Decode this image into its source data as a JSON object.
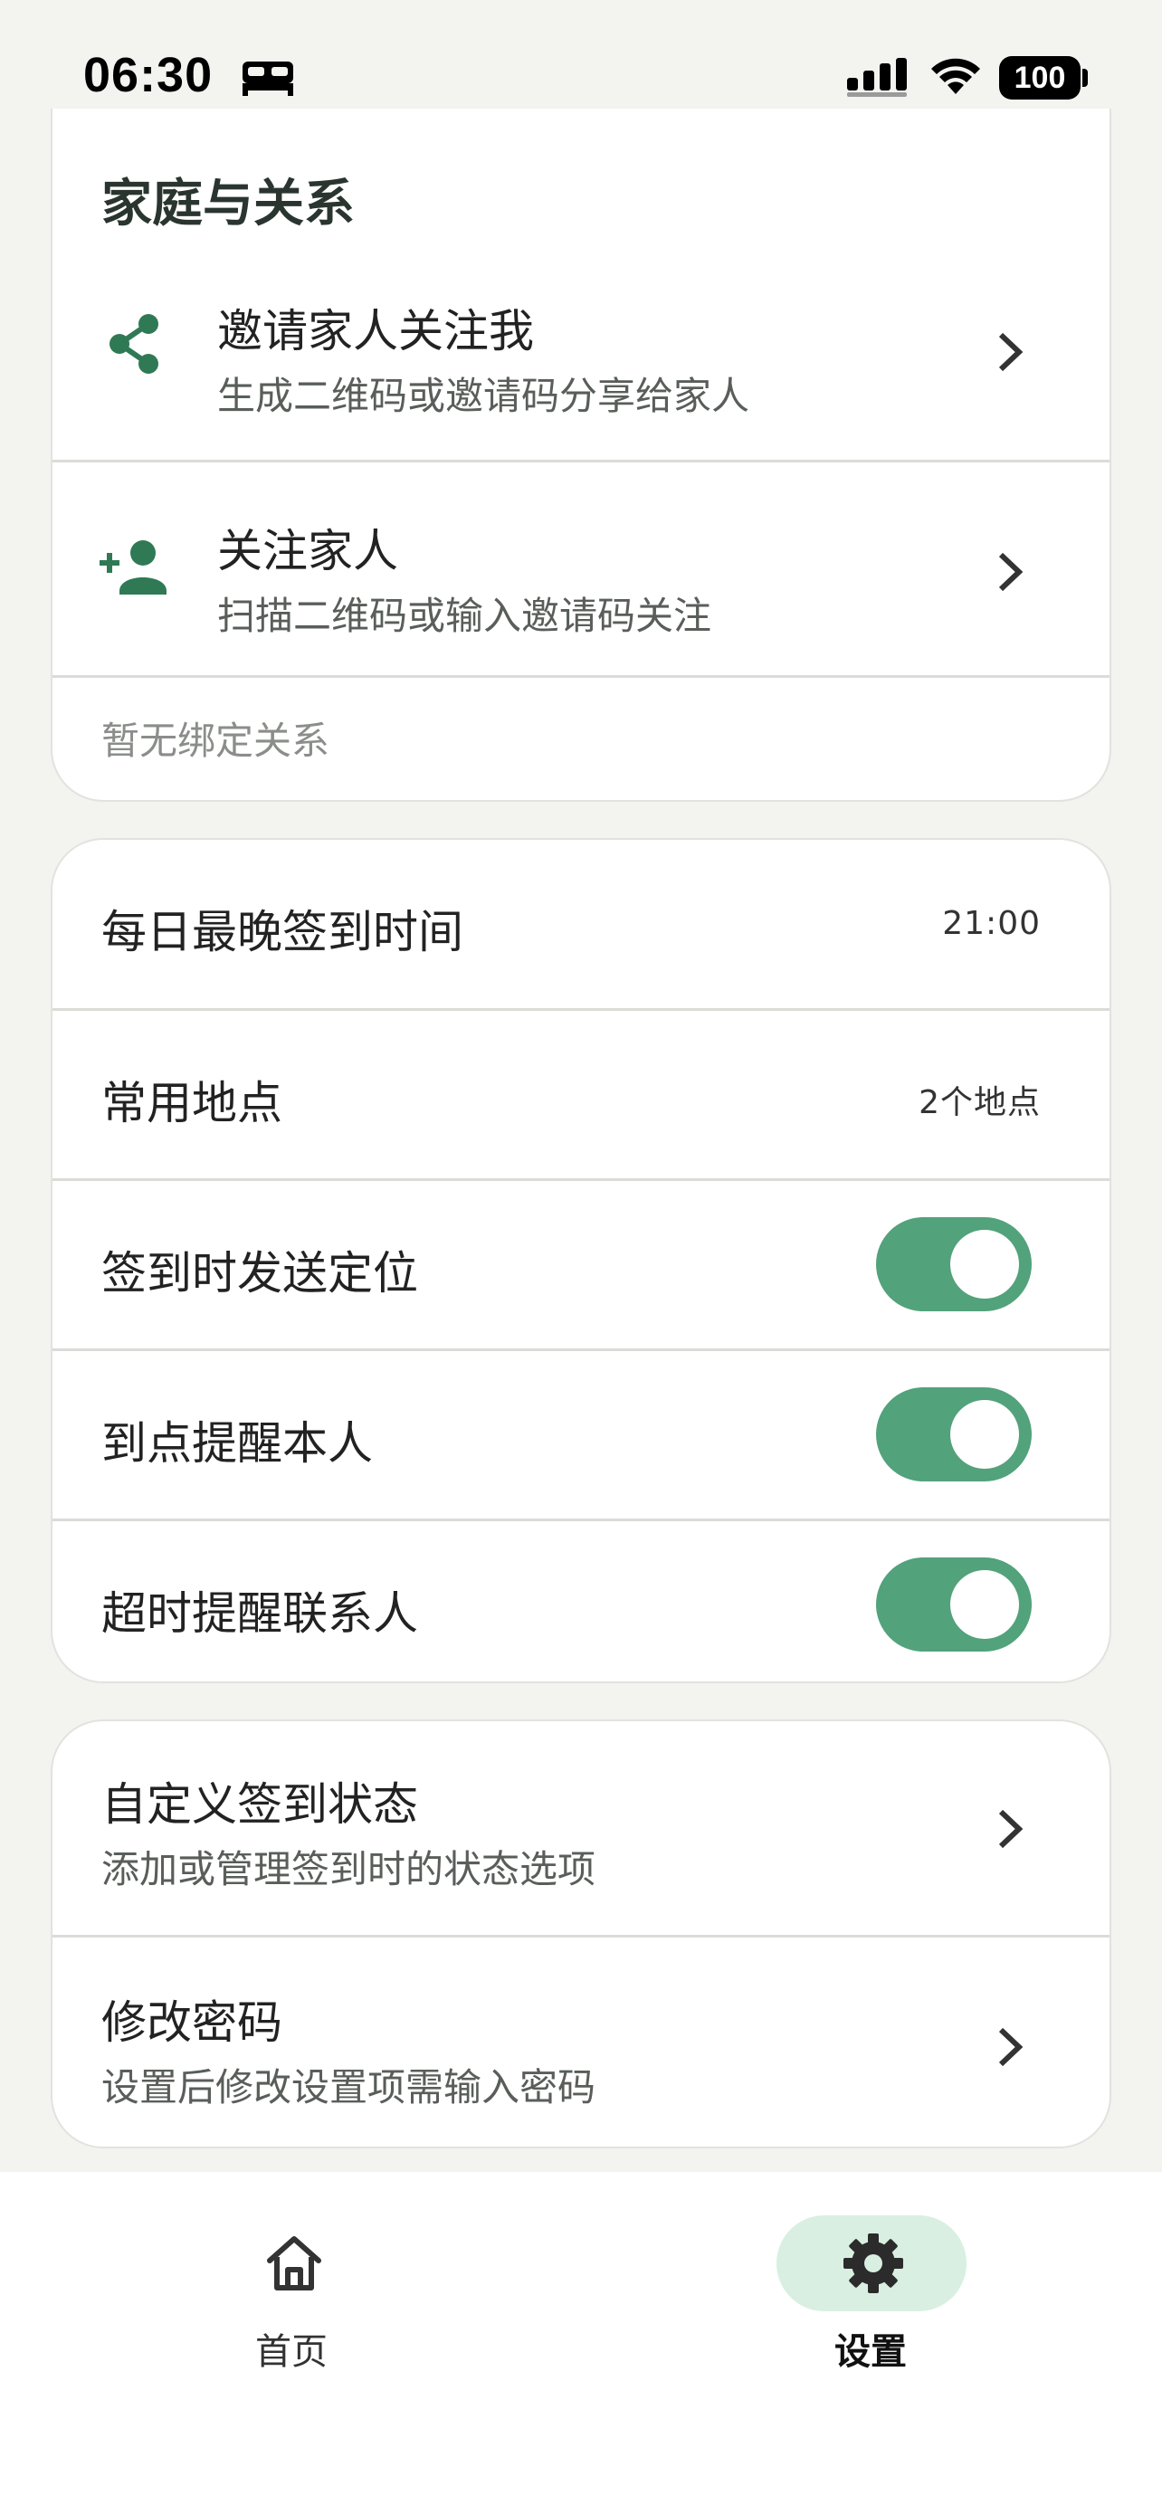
{
  "status_bar": {
    "time": "06:30",
    "battery": "100"
  },
  "family": {
    "title": "家庭与关系",
    "items": [
      {
        "title": "邀请家人关注我",
        "subtitle": "生成二维码或邀请码分享给家人",
        "icon": "share-icon"
      },
      {
        "title": "关注家人",
        "subtitle": "扫描二维码或输入邀请码关注",
        "icon": "add-person-icon"
      }
    ],
    "empty_note": "暂无绑定关系"
  },
  "settings": {
    "checkin_deadline": {
      "label": "每日最晚签到时间",
      "value": "21:00"
    },
    "common_places": {
      "label": "常用地点",
      "value": "2个地点"
    },
    "toggles": [
      {
        "label": "签到时发送定位",
        "on": true
      },
      {
        "label": "到点提醒本人",
        "on": true
      },
      {
        "label": "超时提醒联系人",
        "on": true
      }
    ]
  },
  "misc": {
    "items": [
      {
        "title": "自定义签到状态",
        "subtitle": "添加或管理签到时的状态选项"
      },
      {
        "title": "修改密码",
        "subtitle": "设置后修改设置项需输入密码"
      }
    ]
  },
  "nav": {
    "home_label": "首页",
    "settings_label": "设置",
    "active": "settings"
  },
  "colors": {
    "accent": "#52a27b",
    "icon_green": "#2f7a55",
    "active_pill": "#d9efe2",
    "background": "#f3f4f0"
  }
}
